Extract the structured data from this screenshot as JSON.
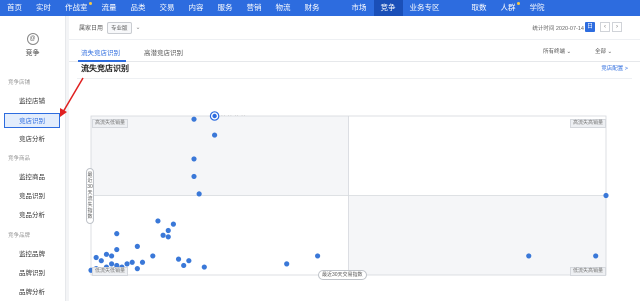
{
  "nav": {
    "items": [
      {
        "label": "首页",
        "dot": false
      },
      {
        "label": "实时",
        "dot": false
      },
      {
        "label": "作战室",
        "dot": true
      },
      {
        "label": "流量",
        "dot": false
      },
      {
        "label": "品类",
        "dot": false
      },
      {
        "label": "交易",
        "dot": false
      },
      {
        "label": "内容",
        "dot": false
      },
      {
        "label": "服务",
        "dot": false
      },
      {
        "label": "营销",
        "dot": false
      },
      {
        "label": "物流",
        "dot": false
      },
      {
        "label": "财务",
        "dot": false
      },
      {
        "label": "市场",
        "dot": false
      },
      {
        "label": "竞争",
        "dot": false,
        "active": true
      },
      {
        "label": "业务专区",
        "dot": false
      },
      {
        "label": "取数",
        "dot": false
      },
      {
        "label": "人群",
        "dot": true
      },
      {
        "label": "学院",
        "dot": false
      }
    ],
    "accent": "#2d6cdf"
  },
  "sidebar": {
    "icon": "at-icon",
    "title": "竞争",
    "sections": [
      {
        "title": "竞争店铺",
        "items": [
          "监控店铺",
          "竞店识别",
          "竞店分析"
        ]
      },
      {
        "title": "竞争商品",
        "items": [
          "监控商品",
          "竞品识别",
          "竞品分析"
        ]
      },
      {
        "title": "竞争品牌",
        "items": [
          "监控品牌",
          "品牌识别",
          "品牌分析"
        ]
      }
    ],
    "active_item": "竞店识别"
  },
  "filter": {
    "label": "属家日用",
    "badge": "专业版",
    "stat_time": "统计时间 2020-07-14",
    "day_button": "日",
    "prev": "‹",
    "next": "›"
  },
  "tabs": {
    "items": [
      "流失竞店识别",
      "高潜竞店识别"
    ],
    "active": 0,
    "terminal": "所有终端",
    "category": "全部"
  },
  "panel": {
    "title": "流失竞店识别",
    "link": "竞店配置 >"
  },
  "chart_data": {
    "type": "scatter",
    "quadrants": {
      "top_left": "高流失低销量",
      "top_right": "高流失高销量",
      "bottom_left": "低流失低销量",
      "bottom_right": "低流失高销量"
    },
    "xlabel": "最近30天交易指数",
    "ylabel": "最近30天流失指数",
    "focus_label": "·· ·· ·· ··",
    "xlim": [
      0,
      100
    ],
    "ylim": [
      0,
      100
    ],
    "points": [
      {
        "x": 24,
        "y": 88
      },
      {
        "x": 20,
        "y": 98
      },
      {
        "x": 20,
        "y": 73
      },
      {
        "x": 20,
        "y": 62
      },
      {
        "x": 21,
        "y": 51
      },
      {
        "x": 100,
        "y": 50
      },
      {
        "x": 5,
        "y": 26
      },
      {
        "x": 13,
        "y": 34
      },
      {
        "x": 16,
        "y": 32
      },
      {
        "x": 15,
        "y": 28
      },
      {
        "x": 14,
        "y": 25
      },
      {
        "x": 15,
        "y": 24
      },
      {
        "x": 9,
        "y": 18
      },
      {
        "x": 5,
        "y": 16
      },
      {
        "x": 3,
        "y": 13
      },
      {
        "x": 4,
        "y": 12
      },
      {
        "x": 1,
        "y": 11
      },
      {
        "x": 2,
        "y": 9
      },
      {
        "x": 4,
        "y": 7
      },
      {
        "x": 5,
        "y": 6
      },
      {
        "x": 3,
        "y": 5
      },
      {
        "x": 6,
        "y": 5
      },
      {
        "x": 7,
        "y": 7
      },
      {
        "x": 8,
        "y": 8
      },
      {
        "x": 9,
        "y": 4
      },
      {
        "x": 10,
        "y": 8
      },
      {
        "x": 1,
        "y": 4
      },
      {
        "x": 0,
        "y": 3
      },
      {
        "x": 2,
        "y": 2
      },
      {
        "x": 12,
        "y": 12
      },
      {
        "x": 17,
        "y": 10
      },
      {
        "x": 18,
        "y": 6
      },
      {
        "x": 19,
        "y": 9
      },
      {
        "x": 22,
        "y": 5
      },
      {
        "x": 38,
        "y": 7
      },
      {
        "x": 44,
        "y": 12
      },
      {
        "x": 85,
        "y": 12
      },
      {
        "x": 98,
        "y": 12
      }
    ],
    "focus": {
      "x": 24,
      "y": 100
    },
    "point_color": "#3a78d8",
    "grid": false
  }
}
